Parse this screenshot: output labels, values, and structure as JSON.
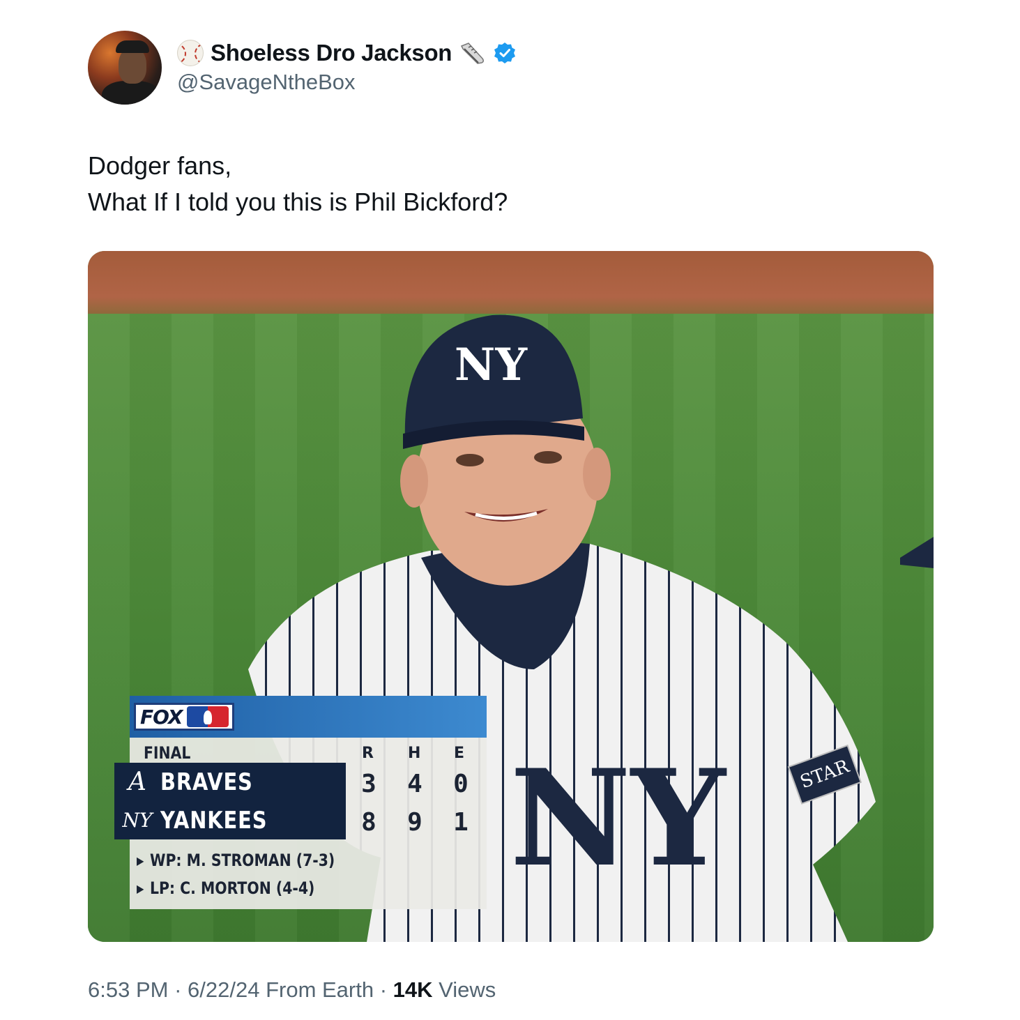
{
  "author": {
    "display_name": "Shoeless Dro Jackson",
    "handle": "@SavageNtheBox",
    "name_prefix_icon": "baseball-icon",
    "name_suffix_icon": "sneaker-icon",
    "verified": true,
    "verified_color": "#1d9bf0"
  },
  "tweet": {
    "lines": [
      "Dodger fans,",
      "What If I told you this is Phil Bickford?"
    ]
  },
  "media": {
    "scoreboard": {
      "network": "FOX",
      "status": "FINAL",
      "columns": [
        "R",
        "H",
        "E"
      ],
      "teams": [
        {
          "logo": "A",
          "name": "BRAVES",
          "r": "3",
          "h": "4",
          "e": "0"
        },
        {
          "logo": "NY",
          "name": "YANKEES",
          "r": "8",
          "h": "9",
          "e": "1"
        }
      ],
      "wp": "WP: M. STROMAN (7-3)",
      "lp": "LP: C. MORTON (4-4)"
    },
    "cap_logo": "NY",
    "jersey_logo": "NY",
    "sleeve_patch": "STAR"
  },
  "footer": {
    "time": "6:53 PM",
    "sep1": " · ",
    "date": "6/22/24",
    "source": " From Earth",
    "sep2": " · ",
    "views_count": "14K",
    "views_label": " Views"
  },
  "colors": {
    "text_primary": "#0f1419",
    "text_secondary": "#536471",
    "yankees_navy": "#1c2841"
  }
}
